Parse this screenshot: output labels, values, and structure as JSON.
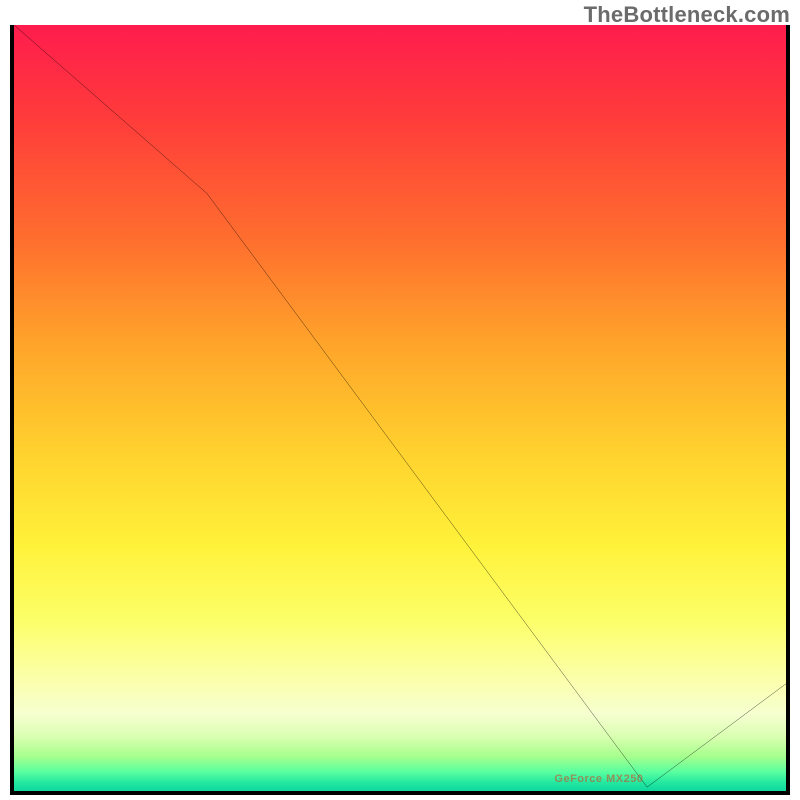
{
  "watermark": "TheBottleneck.com",
  "bottom_label": "GeForce MX250",
  "colors": {
    "line": "#000000",
    "frame": "#000000",
    "watermark_text": "#6b6b6b",
    "bottom_label_text": "#d64020"
  },
  "chart_data": {
    "type": "line",
    "title": "",
    "xlabel": "",
    "ylabel": "",
    "xlim": [
      0,
      100
    ],
    "ylim": [
      0,
      100
    ],
    "grid": false,
    "legend": false,
    "series": [
      {
        "name": "curve",
        "x": [
          0,
          25,
          82,
          100
        ],
        "values": [
          100,
          78,
          0.5,
          14
        ]
      }
    ],
    "annotations": [
      {
        "text": "GeForce MX250",
        "x": 77,
        "y": 1
      }
    ],
    "background_gradient_stops": [
      {
        "pct": 0,
        "hex": "#ff1c4d"
      },
      {
        "pct": 12,
        "hex": "#ff3b3b"
      },
      {
        "pct": 28,
        "hex": "#ff6e2e"
      },
      {
        "pct": 42,
        "hex": "#ffa52a"
      },
      {
        "pct": 56,
        "hex": "#ffd22e"
      },
      {
        "pct": 68,
        "hex": "#fff23a"
      },
      {
        "pct": 78,
        "hex": "#fcff6a"
      },
      {
        "pct": 86,
        "hex": "#fbffb0"
      },
      {
        "pct": 90,
        "hex": "#f6ffd0"
      },
      {
        "pct": 93,
        "hex": "#d8ffb0"
      },
      {
        "pct": 95.5,
        "hex": "#a6ff8d"
      },
      {
        "pct": 97.5,
        "hex": "#5affa0"
      },
      {
        "pct": 99,
        "hex": "#20e6a0"
      },
      {
        "pct": 100,
        "hex": "#10d79e"
      }
    ]
  }
}
